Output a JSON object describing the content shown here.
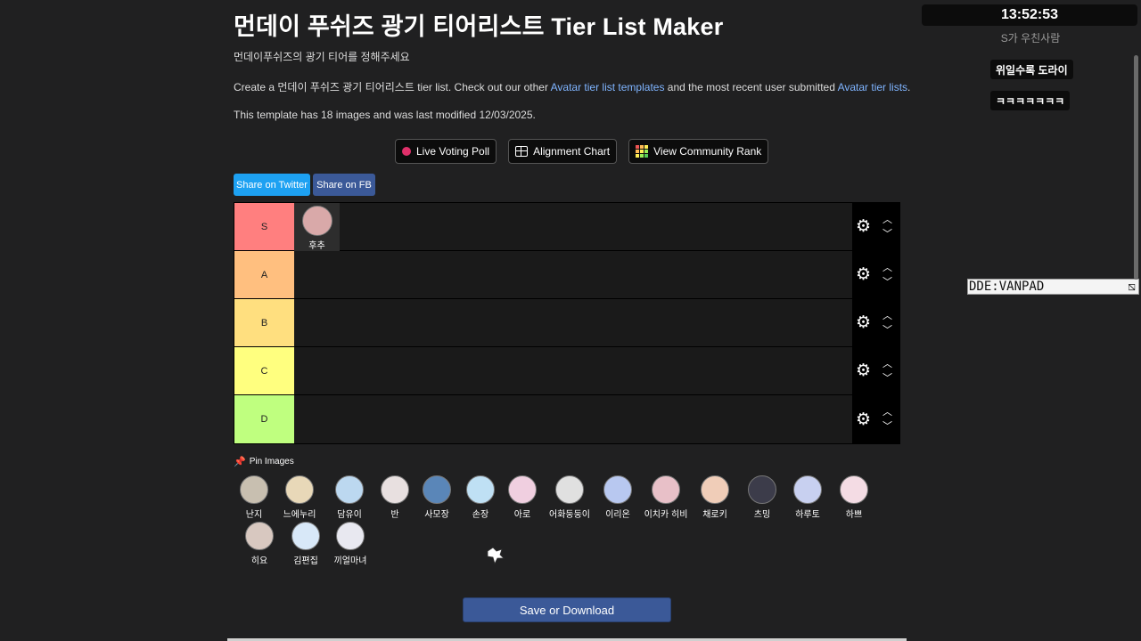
{
  "header": {
    "title": "먼데이 푸쉬즈 광기 티어리스트 Tier List Maker",
    "subtitle": "먼데이푸쉬즈의 광기 티어를 정해주세요",
    "create_prefix": "Create a 먼데이 푸쉬즈 광기 티어리스트 tier list. Check out our other ",
    "link_templates": "Avatar tier list templates",
    "create_middle": " and the most recent user submitted ",
    "link_recent": "Avatar tier lists",
    "create_suffix": ".",
    "template_info": "This template has 18 images and was last modified 12/03/2025."
  },
  "actions": {
    "live_voting": "Live Voting Poll",
    "alignment": "Alignment Chart",
    "community": "View Community Rank"
  },
  "share": {
    "twitter": "Share on Twitter",
    "fb": "Share on FB"
  },
  "tiers": [
    {
      "label": "S",
      "color": "#ff7f7f",
      "items": [
        {
          "name": "후추",
          "color": "#d9a9a9"
        }
      ]
    },
    {
      "label": "A",
      "color": "#ffbf7f",
      "items": []
    },
    {
      "label": "B",
      "color": "#ffdf7f",
      "items": []
    },
    {
      "label": "C",
      "color": "#ffff7f",
      "items": []
    },
    {
      "label": "D",
      "color": "#bfff7f",
      "items": []
    }
  ],
  "pool": {
    "pin_label": "Pin Images",
    "items": [
      {
        "name": "난지",
        "color": "#c8bfb0"
      },
      {
        "name": "느에누리",
        "color": "#e8d8b8"
      },
      {
        "name": "담유이",
        "color": "#bcd8f0"
      },
      {
        "name": "반",
        "color": "#e8e0e0"
      },
      {
        "name": "사모장",
        "color": "#5a86b8"
      },
      {
        "name": "손장",
        "color": "#bfe0f4"
      },
      {
        "name": "아로",
        "color": "#f0cfe0"
      },
      {
        "name": "어화둥둥이",
        "color": "#e0e0e0"
      },
      {
        "name": "이리온",
        "color": "#b8c8f0"
      },
      {
        "name": "이치카 히비",
        "color": "#e8c0c8"
      },
      {
        "name": "채로키",
        "color": "#f0cdb8"
      },
      {
        "name": "츠밍",
        "color": "#3c3c4a"
      },
      {
        "name": "하루토",
        "color": "#c8d0f0"
      },
      {
        "name": "하쁘",
        "color": "#f4dce4"
      },
      {
        "name": "히요",
        "color": "#d8c8c0"
      },
      {
        "name": "김편집",
        "color": "#d8e8f8"
      },
      {
        "name": "끼얼마녀",
        "color": "#e8e8f0"
      }
    ]
  },
  "save_label": "Save or Download",
  "overlay": {
    "clock": "13:52:53",
    "fade_text": "S가 우친사람",
    "chip1": "위일수록 도라이",
    "chip2": "ㅋㅋㅋㅋㅋㅋㅋ",
    "code": "DDE:VANPAD"
  }
}
